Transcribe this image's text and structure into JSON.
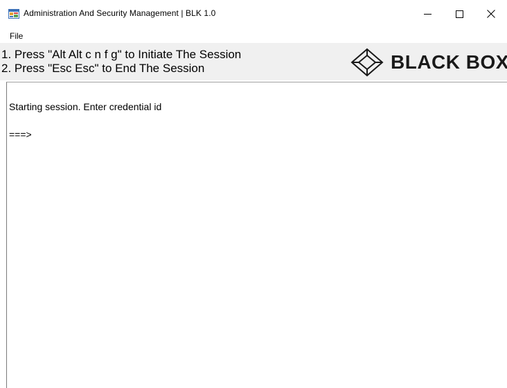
{
  "window": {
    "title": "Administration And Security Management",
    "title_separator": "|",
    "version": "BLK 1.0",
    "controls": {
      "minimize": "–",
      "maximize": "☐",
      "close": "✕"
    }
  },
  "menu": {
    "items": [
      "File"
    ]
  },
  "banner": {
    "instructions": [
      "1. Press \"Alt Alt c n f g\" to Initiate The Session",
      "2. Press \"Esc Esc\" to End The Session"
    ],
    "logo_text": "BLACK BOX"
  },
  "console": {
    "lines": [
      "Starting session. Enter credential id",
      "===>"
    ]
  },
  "icons": {
    "app": "app-window-icon",
    "logo": "black-box-diamond-logo"
  },
  "colors": {
    "banner_bg": "#f0f0f0",
    "logo_text": "#1a1a1a"
  }
}
